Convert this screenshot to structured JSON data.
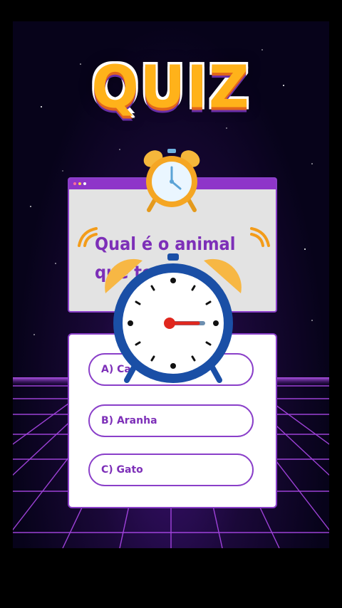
{
  "title": "QUIZ",
  "question": {
    "line1": "Qual é o animal",
    "line2": "que tem"
  },
  "options": [
    {
      "label": "A)  Ca"
    },
    {
      "label": "B)  Aranha"
    },
    {
      "label": "C) Gato"
    }
  ],
  "colors": {
    "accent_purple": "#8a3fc9",
    "text_purple": "#7d2fb8",
    "title_orange": "#ffb21a",
    "clock_blue": "#1a4fa6",
    "clock_bell": "#f5b73b"
  },
  "icons": [
    "alarm-clock-icon-small",
    "alarm-clock-icon-large"
  ]
}
